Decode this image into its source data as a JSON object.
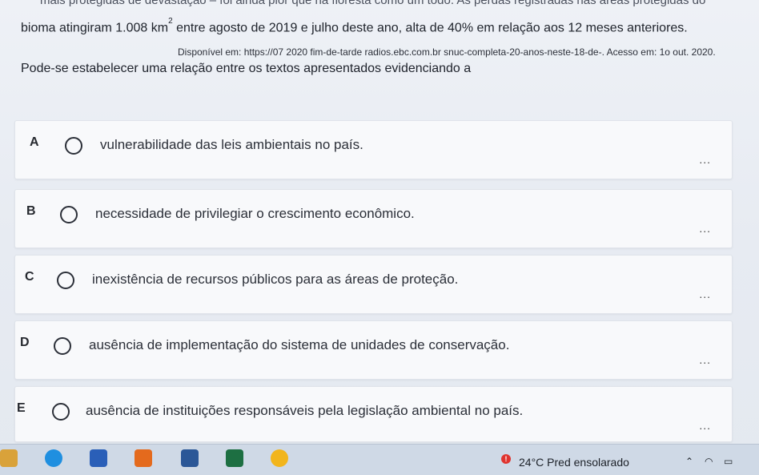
{
  "top_text": "mais protegidas de devastação – foi ainda pior que na floresta como um todo. As perdas registradas nas áreas protegidas do",
  "line1": {
    "before": "bioma atingiram 1.008 km",
    "sup": "2",
    "after": " entre agosto de 2019 e julho deste ano, alta de 40% em relação aos 12 meses anteriores."
  },
  "source": "Disponível em: https://07 2020 fim-de-tarde radios.ebc.com.br snuc-completa-20-anos-neste-18-de-. Acesso em: 1o out. 2020.",
  "question": "Pode-se estabelecer uma relação entre os textos apresentados evidenciando a",
  "options": [
    {
      "letter": "A",
      "text": "vulnerabilidade das leis ambientais no país.",
      "more": "..."
    },
    {
      "letter": "B",
      "text": "necessidade de privilegiar o crescimento econômico.",
      "more": "..."
    },
    {
      "letter": "C",
      "text": "inexistência de recursos públicos para as áreas de proteção.",
      "more": "..."
    },
    {
      "letter": "D",
      "text": "ausência de implementação do sistema de unidades de conservação.",
      "more": "..."
    },
    {
      "letter": "E",
      "text": "ausência de instituições responsáveis pela legislação ambiental no país.",
      "more": "..."
    }
  ],
  "taskbar": {
    "temperature": "24°C",
    "weather": "Pred ensolarado",
    "warning_badge": "!",
    "icons": [
      "app-icon",
      "edge-browser-icon",
      "store-icon",
      "office-icon",
      "word-icon",
      "excel-icon",
      "chrome-icon"
    ],
    "icon_colors": [
      "#d9a23a",
      "#1f8fe0",
      "#2a5fb8",
      "#e46a1d",
      "#2b5797",
      "#1d6f42",
      "#f2b51c"
    ]
  }
}
